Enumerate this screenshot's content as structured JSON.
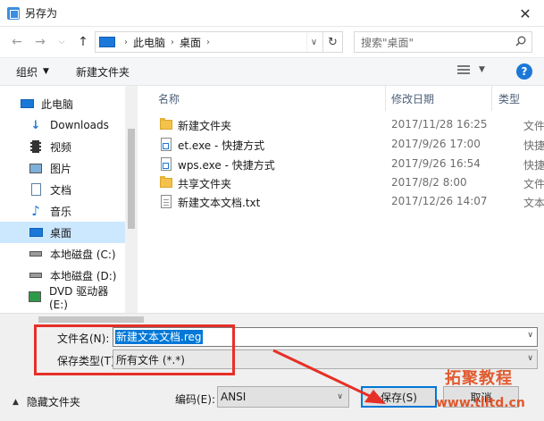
{
  "window": {
    "title": "另存为",
    "close_symbol": "✕"
  },
  "nav": {
    "breadcrumb": [
      "此电脑",
      "桌面"
    ],
    "search_placeholder": "搜索\"桌面\""
  },
  "toolbar": {
    "organize": "组织",
    "new_folder": "新建文件夹"
  },
  "sidebar": {
    "items": [
      {
        "label": "此电脑",
        "icon": "computer-icon"
      },
      {
        "label": "Downloads",
        "icon": "download-icon"
      },
      {
        "label": "视频",
        "icon": "video-icon"
      },
      {
        "label": "图片",
        "icon": "picture-icon"
      },
      {
        "label": "文档",
        "icon": "document-icon"
      },
      {
        "label": "音乐",
        "icon": "music-icon"
      },
      {
        "label": "桌面",
        "icon": "desktop-icon"
      },
      {
        "label": "本地磁盘 (C:)",
        "icon": "drive-icon"
      },
      {
        "label": "本地磁盘 (D:)",
        "icon": "drive-icon"
      },
      {
        "label": "DVD 驱动器 (E:)",
        "icon": "dvd-icon"
      }
    ]
  },
  "columns": {
    "name": "名称",
    "date": "修改日期",
    "type": "类型"
  },
  "files": [
    {
      "name": "新建文件夹",
      "date": "2017/11/28 16:25",
      "type": "文件夹",
      "icon": "folder-icon"
    },
    {
      "name": "et.exe - 快捷方式",
      "date": "2017/9/26 17:00",
      "type": "快捷方式",
      "icon": "shortcut-icon"
    },
    {
      "name": "wps.exe - 快捷方式",
      "date": "2017/9/26 16:54",
      "type": "快捷方式",
      "icon": "shortcut-icon"
    },
    {
      "name": "共享文件夹",
      "date": "2017/8/2 8:00",
      "type": "文件夹",
      "icon": "folder-icon"
    },
    {
      "name": "新建文本文档.txt",
      "date": "2017/12/26 14:07",
      "type": "文本文档",
      "icon": "text-file-icon"
    }
  ],
  "bottom": {
    "filename_label": "文件名(N):",
    "filename_value": "新建文本文档.reg",
    "filetype_label": "保存类型(T):",
    "filetype_value": "所有文件  (*.*)",
    "hide_folders": "隐藏文件夹",
    "encoding_label": "编码(E):",
    "encoding_value": "ANSI",
    "save_button": "保存(S)",
    "cancel_button": "取消"
  },
  "watermark": {
    "line1": "拓聚教程",
    "line2": "www.tlltd.cn"
  },
  "colors": {
    "accent": "#0078d7",
    "highlight_box": "#e63027",
    "selection_bg": "#cce8ff"
  }
}
